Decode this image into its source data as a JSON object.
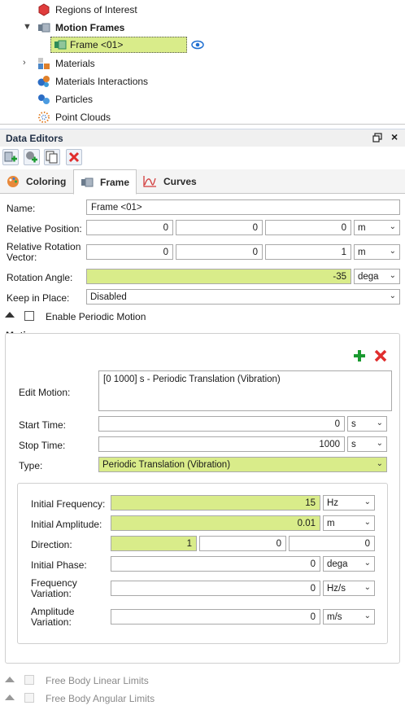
{
  "tree": {
    "items": [
      {
        "label": "Regions of Interest",
        "icon": "regions-icon"
      },
      {
        "label": "Motion Frames",
        "icon": "motion-frames-icon"
      },
      {
        "label": "Frame <01>",
        "icon": "frame-icon"
      },
      {
        "label": "Materials",
        "icon": "materials-icon"
      },
      {
        "label": "Materials Interactions",
        "icon": "materials-interactions-icon"
      },
      {
        "label": "Particles",
        "icon": "particles-icon"
      },
      {
        "label": "Point Clouds",
        "icon": "point-clouds-icon"
      }
    ]
  },
  "data_editors": {
    "title": "Data Editors",
    "tabs": [
      {
        "label": "Coloring",
        "icon": "palette-icon"
      },
      {
        "label": "Frame",
        "icon": "frame-icon"
      },
      {
        "label": "Curves",
        "icon": "curve-chart-icon"
      }
    ]
  },
  "form": {
    "name_label": "Name:",
    "name_value": "Frame <01>",
    "rel_pos_label": "Relative Position:",
    "rel_pos": [
      "0",
      "0",
      "0"
    ],
    "rel_pos_unit": "m",
    "rel_rot_label": "Relative Rotation Vector:",
    "rel_rot": [
      "0",
      "0",
      "1"
    ],
    "rel_rot_unit": "m",
    "rot_angle_label": "Rotation Angle:",
    "rot_angle": "-35",
    "rot_angle_unit": "dega",
    "keep_label": "Keep in Place:",
    "keep_value": "Disabled",
    "periodic_label": "Enable Periodic Motion"
  },
  "motions": {
    "title": "Motions",
    "edit_label": "Edit Motion:",
    "edit_value": "[0 1000] s - Periodic Translation (Vibration)",
    "start_label": "Start Time:",
    "start_value": "0",
    "start_unit": "s",
    "stop_label": "Stop Time:",
    "stop_value": "1000",
    "stop_unit": "s",
    "type_label": "Type:",
    "type_value": "Periodic Translation (Vibration)",
    "freq_label": "Initial Frequency:",
    "freq_value": "15",
    "freq_unit": "Hz",
    "amp_label": "Initial Amplitude:",
    "amp_value": "0.01",
    "amp_unit": "m",
    "dir_label": "Direction:",
    "dir_values": [
      "1",
      "0",
      "0"
    ],
    "phase_label": "Initial Phase:",
    "phase_value": "0",
    "phase_unit": "dega",
    "freqvar_label": "Frequency Variation:",
    "freqvar_value": "0",
    "freqvar_unit": "Hz/s",
    "ampvar_label": "Amplitude Variation:",
    "ampvar_value": "0",
    "ampvar_unit": "m/s"
  },
  "bottom": {
    "linear_label": "Free Body Linear Limits",
    "angular_label": "Free Body Angular Limits"
  }
}
